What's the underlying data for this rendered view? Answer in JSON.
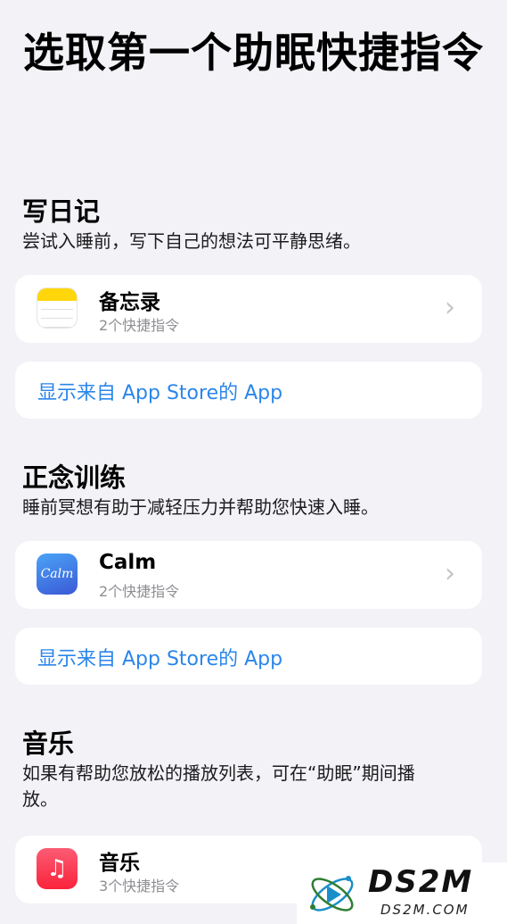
{
  "page_title": "选取第一个助眠快捷指令",
  "sections": [
    {
      "title": "写日记",
      "description": "尝试入睡前，写下自己的想法可平静思绪。",
      "app": {
        "name": "备忘录",
        "subtitle": "2个快捷指令",
        "icon": "notes-icon"
      },
      "link": "显示来自 App Store的 App"
    },
    {
      "title": "正念训练",
      "description": "睡前冥想有助于减轻压力并帮助您快速入睡。",
      "app": {
        "name": "Calm",
        "subtitle": "2个快捷指令",
        "icon": "calm-icon",
        "icon_text": "Calm"
      },
      "link": "显示来自 App Store的 App"
    },
    {
      "title": "音乐",
      "description": "如果有帮助您放松的播放列表，可在“助眠”期间播放。",
      "app": {
        "name": "音乐",
        "subtitle": "3个快捷指令",
        "icon": "music-icon"
      }
    }
  ],
  "chevron": "›",
  "watermark": {
    "title": "DS2M",
    "subtitle": "DS2M.COM"
  },
  "colors": {
    "background": "#f2f2f7",
    "link": "#2b86ea",
    "notes_yellow": "#ffd60a",
    "music_red": "#fa233b"
  }
}
